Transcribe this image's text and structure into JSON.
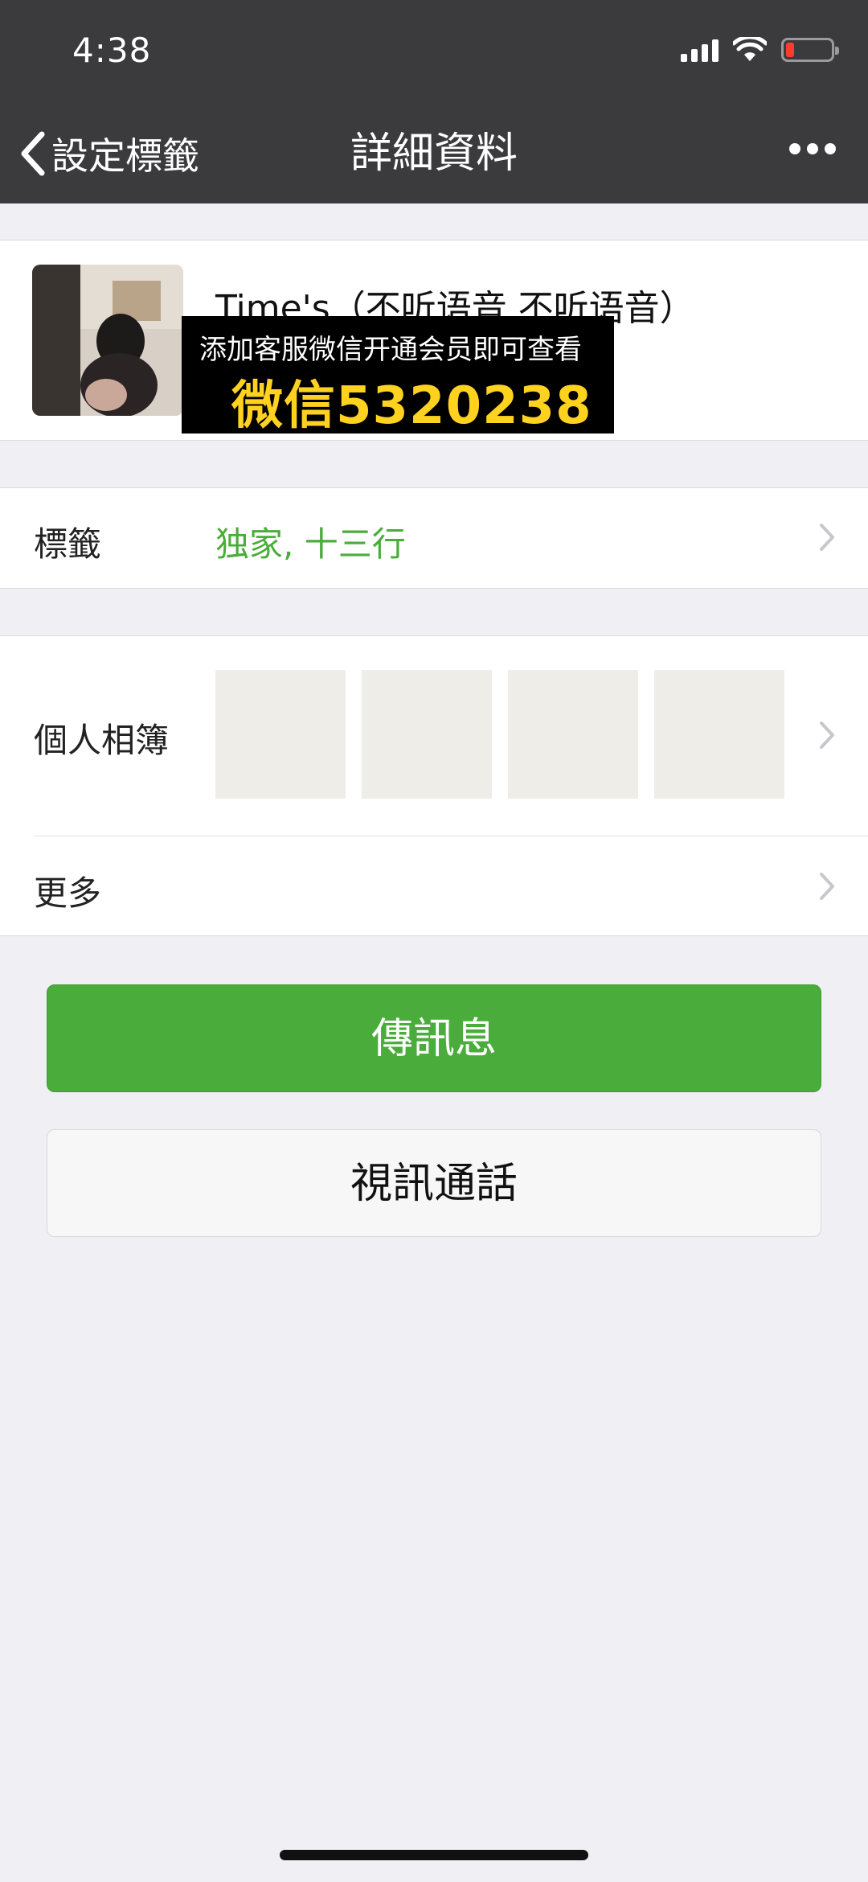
{
  "status_bar": {
    "time": "4:38"
  },
  "nav": {
    "back_label": "設定標籤",
    "title": "詳細資料"
  },
  "profile": {
    "name": "Time's（不听语音 不听语音）"
  },
  "promo": {
    "line1": "添加客服微信开通会员即可查看",
    "line2": "微信5320238"
  },
  "tags_row": {
    "label": "標籤",
    "value": "独家, 十三行"
  },
  "album_row": {
    "label": "個人相簿",
    "photo_count": 4
  },
  "more_row": {
    "label": "更多"
  },
  "buttons": {
    "message": "傳訊息",
    "video_call": "視訊通話"
  },
  "colors": {
    "accent_green": "#4aad3b",
    "nav_bg": "#3b3b3d",
    "page_bg": "#efeff4",
    "promo_yellow": "#ffd21f",
    "battery_low": "#ff3b30"
  },
  "icons": [
    "cellular-signal-icon",
    "wifi-icon",
    "battery-icon",
    "back-chevron-icon",
    "more-dots-icon",
    "chevron-right-icon"
  ]
}
